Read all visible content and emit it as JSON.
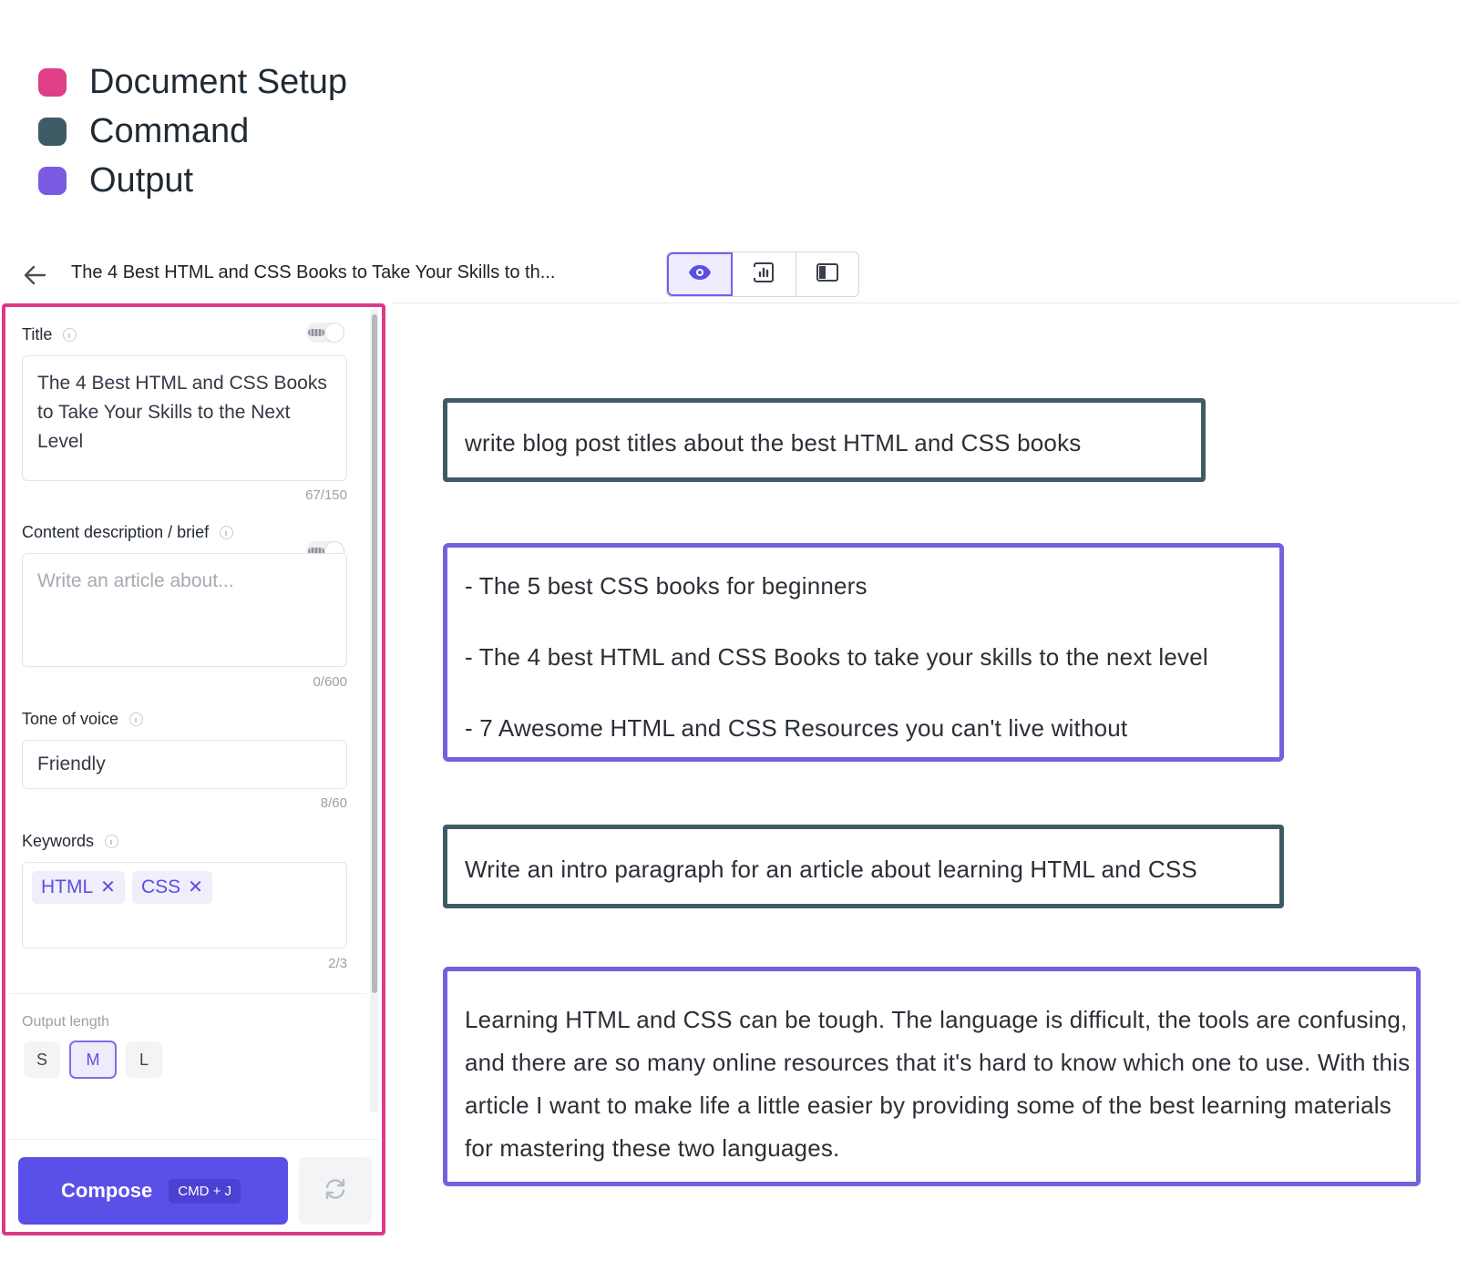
{
  "legend": [
    {
      "label": "Document Setup",
      "color": "#de3f87"
    },
    {
      "label": "Command",
      "color": "#3f5c66"
    },
    {
      "label": "Output",
      "color": "#7a5ae0"
    }
  ],
  "header": {
    "doc_title": "The 4 Best HTML and CSS Books to Take Your Skills to th...",
    "view_buttons": [
      "eye-icon",
      "chart-icon",
      "sidebar-icon"
    ]
  },
  "form": {
    "title": {
      "label": "Title",
      "value": "The 4 Best HTML and CSS Books to Take Your Skills to the Next Level",
      "counter": "67/150"
    },
    "brief": {
      "label": "Content description / brief",
      "placeholder": "Write an article about...",
      "counter": "0/600"
    },
    "tone": {
      "label": "Tone of voice",
      "value": "Friendly",
      "counter": "8/60"
    },
    "keywords": {
      "label": "Keywords",
      "tags": [
        "HTML",
        "CSS"
      ],
      "counter": "2/3"
    },
    "output_length": {
      "label": "Output length",
      "options": [
        "S",
        "M",
        "L"
      ],
      "selected": "M"
    },
    "compose": {
      "label": "Compose",
      "shortcut": "CMD + J"
    }
  },
  "canvas": {
    "command1": "write blog post titles about the best HTML and CSS books",
    "output1": [
      "- The 5 best CSS books for beginners",
      "- The 4 best HTML and CSS Books to take your skills to the next level",
      "- 7 Awesome HTML and CSS Resources you can't live without"
    ],
    "command2": "Write an intro paragraph for an article about learning HTML and CSS",
    "output2": "Learning HTML and CSS can be tough. The language is difficult, the tools are confusing, and there are so many online resources that it's hard to know which one to use. With this article I want to make life a little easier by providing some of the best learning materials for mastering these two languages."
  }
}
